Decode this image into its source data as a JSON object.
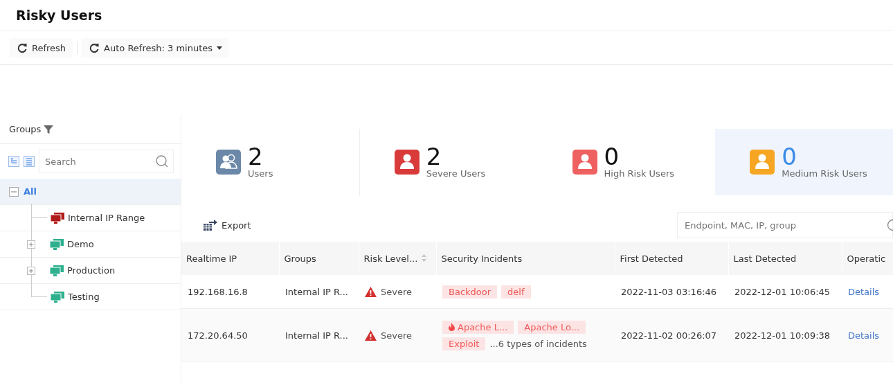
{
  "title": "Risky Users",
  "toolbar": [
    {
      "kind": "button",
      "label": "Refresh"
    },
    {
      "kind": "dropdown",
      "label": "Auto Refresh: 3 minutes"
    }
  ],
  "sidebar": {
    "heading": "Groups",
    "search": {
      "placeholder": "Search"
    },
    "tree": [
      {
        "label": "All",
        "selected": true,
        "expanded": true,
        "children": [
          {
            "label": "Internal IP Range",
            "color": "#b01a1a",
            "selected": false,
            "expandable": false
          },
          {
            "label": "Demo",
            "color": "#2eb08e",
            "selected": false,
            "expandable": true
          },
          {
            "label": "Production",
            "color": "#2eb08e",
            "selected": false,
            "expandable": true
          },
          {
            "label": "Testing",
            "color": "#2eb08e",
            "selected": false,
            "expandable": false
          }
        ]
      }
    ]
  },
  "stats": [
    {
      "kind": "group",
      "count": "2",
      "label": "Users",
      "color": "#6b88a8",
      "selected": false
    },
    {
      "kind": "user",
      "count": "2",
      "label": "Severe Users",
      "color": "#d93b3b",
      "selected": false
    },
    {
      "kind": "user",
      "count": "0",
      "label": "High Risk Users",
      "color": "#ef6060",
      "selected": false
    },
    {
      "kind": "user",
      "count": "0",
      "label": "Medium Risk Users",
      "color": "#f6a623",
      "selected": true
    }
  ],
  "table_toolbar": {
    "export": "Export",
    "search": {
      "placeholder": "Endpoint, MAC, IP, group"
    }
  },
  "table": {
    "columns": [
      {
        "label": "Realtime IP",
        "kind": "plain"
      },
      {
        "label": "Groups",
        "kind": "plain"
      },
      {
        "label": "Risk Level...",
        "kind": "sortable"
      },
      {
        "label": "Security Incidents",
        "kind": "plain"
      },
      {
        "label": "First Detected",
        "kind": "plain"
      },
      {
        "label": "Last Detected",
        "kind": "plain"
      },
      {
        "label": "Operatic",
        "kind": "plain"
      }
    ],
    "rows": [
      {
        "ip": "192.168.16.8",
        "group": "Internal IP R...",
        "risk": "Severe",
        "incidents": [
          {
            "label": "Backdoor",
            "flame": false
          },
          {
            "label": "delf",
            "flame": false
          }
        ],
        "first": "2022-11-03 03:16:46",
        "last": "2022-12-01 10:06:45",
        "action": "Details"
      },
      {
        "ip": "172.20.64.50",
        "group": "Internal IP R...",
        "risk": "Severe",
        "incidents": [
          {
            "label": "Apache L...",
            "flame": true
          },
          {
            "label": "Apache Lo...",
            "flame": false
          },
          {
            "label": "Exploit",
            "flame": false
          }
        ],
        "more": "...6 types of incidents",
        "first": "2022-11-02 00:26:07",
        "last": "2022-12-01 10:09:38",
        "action": "Details"
      }
    ]
  }
}
